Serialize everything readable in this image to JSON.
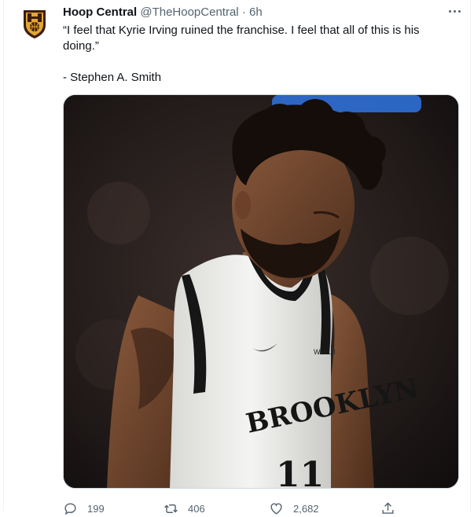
{
  "tweet": {
    "author_name": "Hoop Central",
    "author_handle": "@TheHoopCentral",
    "separator": "·",
    "time_ago": "6h",
    "text": "“I feel that Kyrie Irving ruined the franchise. I feel that all of this is his doing.”",
    "attribution": "- Stephen A. Smith",
    "jersey_wordmark": "BROOKLYN",
    "jersey_number": "11",
    "jersey_sponsor": "Webull"
  },
  "actions": {
    "reply_count": "199",
    "retweet_count": "406",
    "like_count": "2,682"
  },
  "icons": {
    "more": "more-icon",
    "reply": "reply-icon",
    "retweet": "retweet-icon",
    "like": "like-icon",
    "share": "share-icon"
  },
  "colors": {
    "text": "#0f1419",
    "secondary": "#536471",
    "logo_gold": "#e3a72f",
    "logo_dark": "#3b1d0e"
  }
}
